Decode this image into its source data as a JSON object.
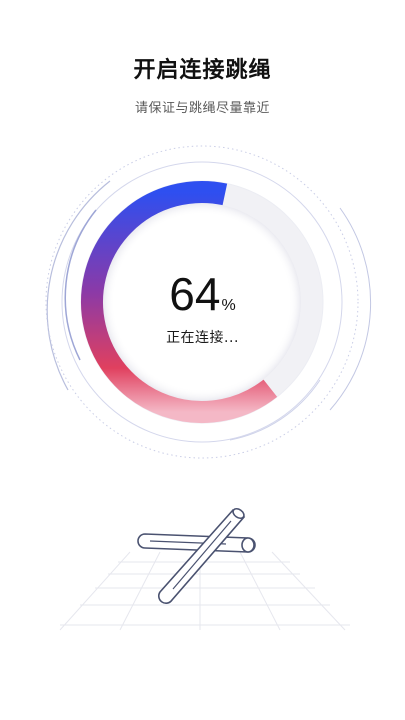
{
  "header": {
    "title": "开启连接跳绳",
    "subtitle": "请保证与跳绳尽量靠近"
  },
  "progress": {
    "value": 64,
    "value_text": "64",
    "unit": "%",
    "status": "正在连接..."
  },
  "colors": {
    "gradient_start": "#2e4ff0",
    "gradient_mid": "#8a3aa8",
    "gradient_end": "#f04a6e",
    "track": "#f1f1f5",
    "decor_ring": "#c9cde6"
  },
  "icons": {
    "illustration": "jump-rope-icon"
  }
}
